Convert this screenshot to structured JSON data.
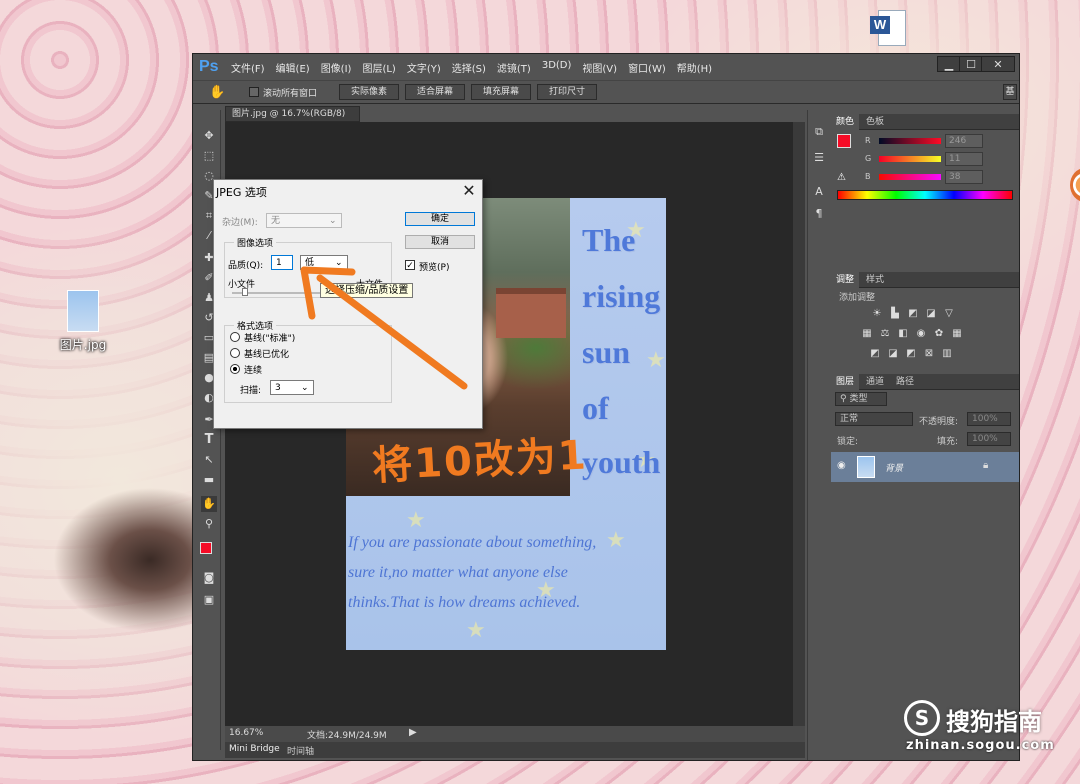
{
  "desktop": {
    "file_icon_label": "图片.jpg",
    "word_icon_letter": "W"
  },
  "ps": {
    "logo": "Ps",
    "menu": [
      "文件(F)",
      "编辑(E)",
      "图像(I)",
      "图层(L)",
      "文字(Y)",
      "选择(S)",
      "滤镜(T)",
      "3D(D)",
      "视图(V)",
      "窗口(W)",
      "帮助(H)"
    ],
    "window_buttons": {
      "minimize": "▁",
      "maximize": "☐",
      "close": "✕"
    },
    "options": {
      "scroll_all_label": "滚动所有窗口",
      "actual_pixels": "实际像素",
      "fit_screen": "适合屏幕",
      "fill_screen": "填充屏幕",
      "print_size": "打印尺寸",
      "workspace": "基"
    },
    "doc_tab": "图片.jpg @ 16.7%(RGB/8)",
    "doc_tab_close": "×",
    "status": {
      "zoom": "16.67%",
      "doc_size": "文档:24.9M/24.9M"
    },
    "bottom_tabs": [
      "Mini Bridge",
      "时间轴"
    ]
  },
  "panels": {
    "color_tabs": [
      "颜色",
      "色板"
    ],
    "color": {
      "r_label": "R",
      "g_label": "G",
      "b_label": "B",
      "r_value": "246",
      "g_value": "11",
      "b_value": "38",
      "fg_color": "#f60b26",
      "bg_color": "#000000"
    },
    "adjust_tabs": [
      "调整",
      "样式"
    ],
    "adjust_title": "添加调整",
    "layers_tabs": [
      "图层",
      "通道",
      "路径"
    ],
    "layers": {
      "filter_type": "类型",
      "blend_mode": "正常",
      "opacity_label": "不透明度:",
      "opacity_value": "100%",
      "lock_label": "锁定:",
      "fill_label": "填充:",
      "fill_value": "100%",
      "layer_name": "背景"
    }
  },
  "document": {
    "poem_lines": [
      "The",
      "rising",
      "sun",
      "of",
      "youth"
    ],
    "quote_lines": [
      "If you are passionate about something,",
      "sure it,no matter what anyone else",
      "thinks.That is how dreams achieved."
    ],
    "annotation": "将10改为1"
  },
  "dialog": {
    "title": "JPEG 选项",
    "close": "✕",
    "matte_label": "杂边(M):",
    "matte_value": "无",
    "ok": "确定",
    "cancel": "取消",
    "preview_label": "预览(P)",
    "preview_checked": true,
    "image_options_title": "图像选项",
    "quality_label": "品质(Q):",
    "quality_value": "1",
    "quality_preset": "低",
    "small_file": "小文件",
    "large_file": "大文件",
    "format_title": "格式选项",
    "format_options": [
      "基线(\"标准\")",
      "基线已优化",
      "连续"
    ],
    "format_selected_index": 2,
    "scans_label": "扫描:",
    "scans_value": "3",
    "tooltip": "选择压缩/品质设置"
  },
  "watermark": {
    "symbol": "S",
    "text": "搜狗指南",
    "url": "zhinan.sogou.com"
  },
  "colors": {
    "accent_arrow": "#f07a20",
    "ps_blue": "#4fa1f1"
  }
}
